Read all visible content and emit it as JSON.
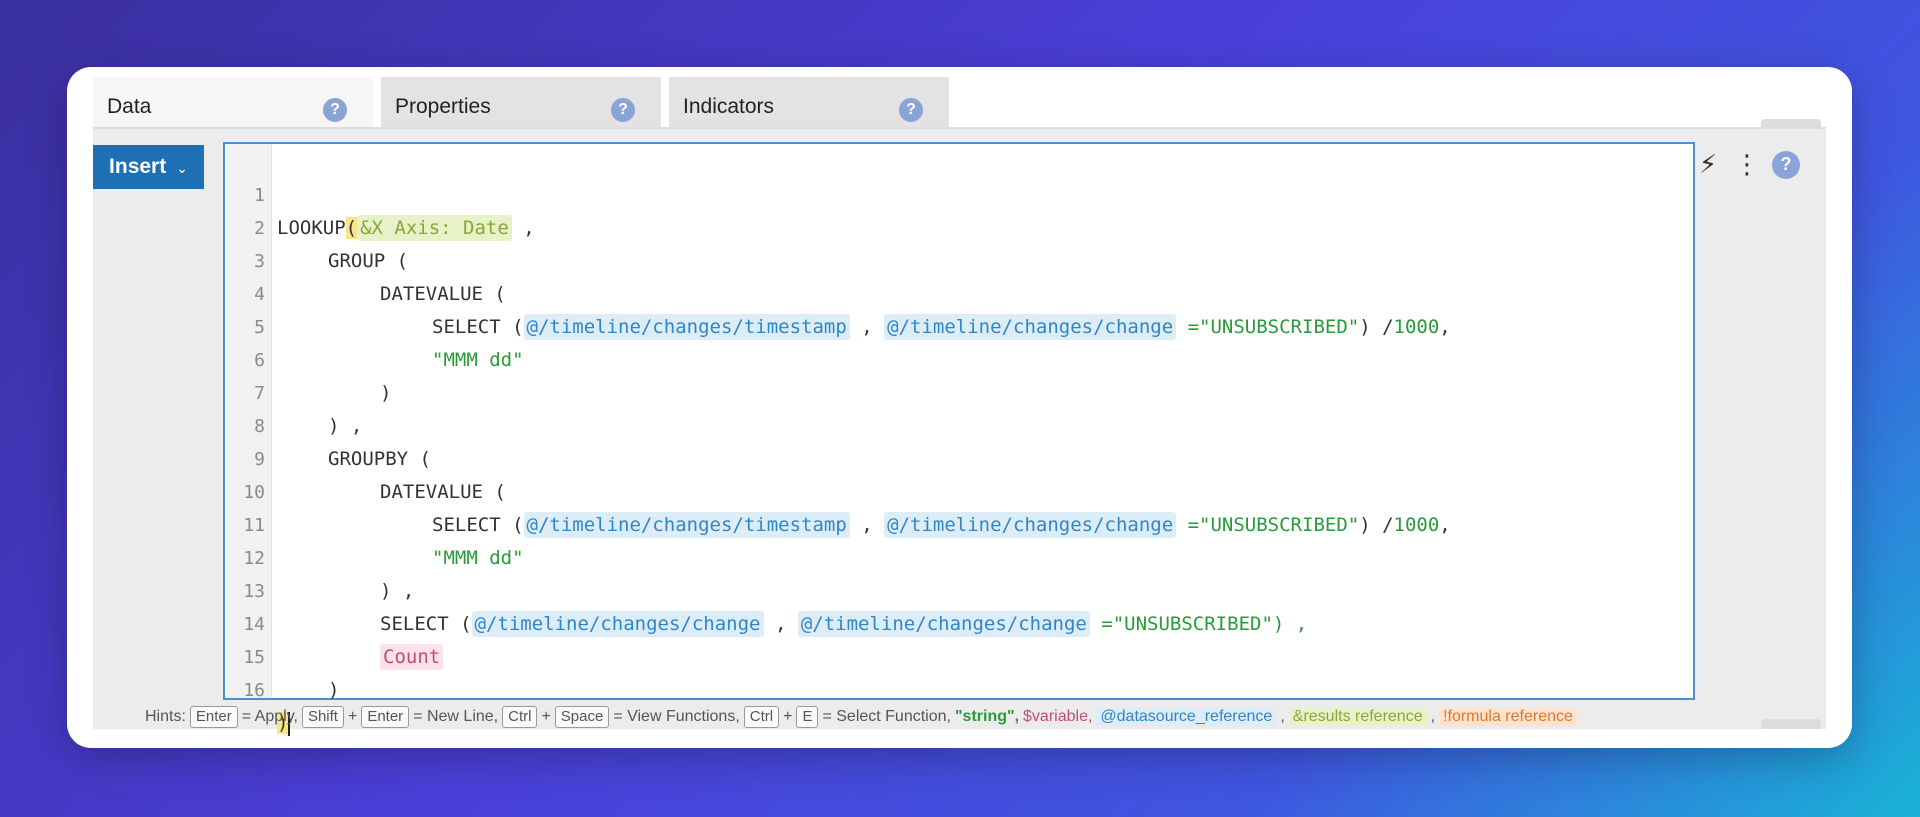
{
  "tabs": [
    {
      "label": "Data",
      "active": true
    },
    {
      "label": "Properties",
      "active": false
    },
    {
      "label": "Indicators",
      "active": false
    }
  ],
  "help_glyph": "?",
  "insert": {
    "label": "Insert",
    "chevron": "⌄"
  },
  "editor": {
    "line_numbers": [
      "1",
      "2",
      "3",
      "4",
      "5",
      "6",
      "7",
      "8",
      "9",
      "10",
      "11",
      "12",
      "13",
      "14",
      "15",
      "16"
    ],
    "tokens": {
      "l1_fn": "LOOKUP",
      "l1_paren": "(",
      "l1_ref": "&X Axis: Date",
      "l1_comma": ",",
      "l2": "GROUP (",
      "l3": "DATEVALUE (",
      "select_fn": "SELECT (",
      "ds_timestamp": "@/timeline/changes/timestamp",
      "ds_change": "@/timeline/changes/change",
      "comma": ",",
      "eq_unsub": "=\"UNSUBSCRIBED\"",
      "close_div": ") /",
      "num_1000": "1000",
      "trail_comma": ",",
      "mmm": "\"MMM dd\"",
      "close": ")",
      "close_comma": ") ,",
      "groupby": "GROUPBY (",
      "unsub_close": "=\"UNSUBSCRIBED\") ,",
      "count": "Count",
      "final_paren": ")"
    }
  },
  "toolbar": {
    "bolt": "⚡",
    "more": "⋮"
  },
  "hints": {
    "label": "Hints:",
    "enter": "Enter",
    "apply": "= Apply,",
    "shift": "Shift",
    "plus": "+",
    "newline": "= New Line,",
    "ctrl": "Ctrl",
    "space": "Space",
    "view_fn": "= View Functions,",
    "e": "E",
    "select_fn": "= Select Function,",
    "string": "\"string\",",
    "variable": "$variable,",
    "ds_ref": "@datasource_reference",
    "comma": ",",
    "res_ref": "&results reference",
    "form_ref": "!formula reference"
  }
}
